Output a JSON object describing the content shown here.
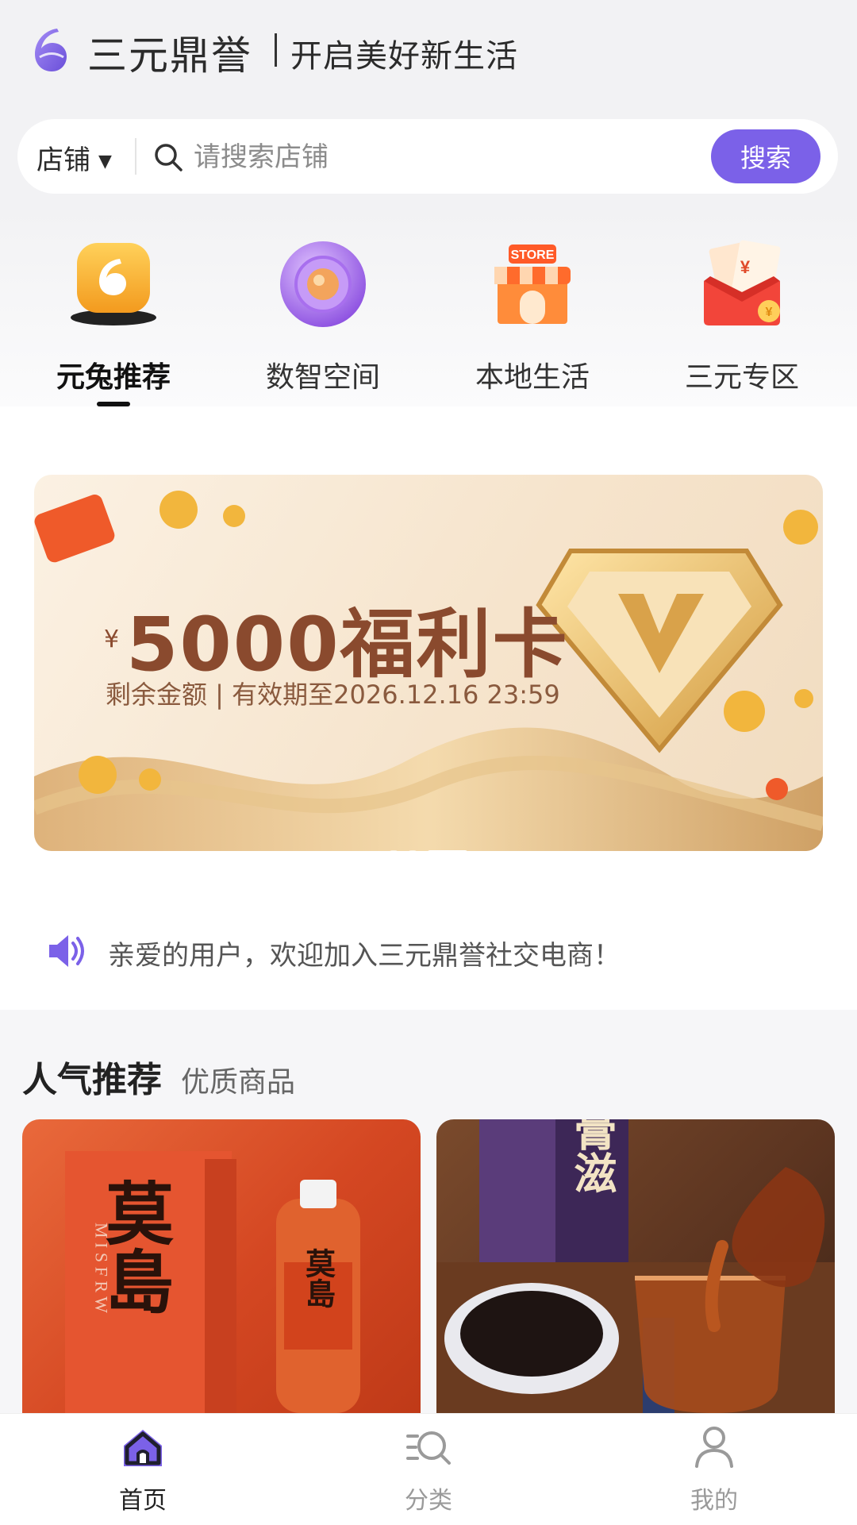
{
  "header": {
    "brand": "三元鼎誉",
    "slogan": "开启美好新生活"
  },
  "search": {
    "scope": "店铺",
    "placeholder": "请搜索店铺",
    "button": "搜索"
  },
  "categories": [
    {
      "label": "元兔推荐",
      "icon": "rabbit-logo-icon",
      "active": true
    },
    {
      "label": "数智空间",
      "icon": "target-orb-icon",
      "active": false
    },
    {
      "label": "本地生活",
      "icon": "store-icon",
      "active": false
    },
    {
      "label": "三元专区",
      "icon": "red-envelope-icon",
      "active": false
    }
  ],
  "banner": {
    "currency": "¥",
    "title": "5000福利卡",
    "subtitle": "剩余金额 | 有效期至2026.12.16 23:59",
    "slide_count": 3,
    "active_slide": 3
  },
  "notice": {
    "text": "亲爱的用户，欢迎加入三元鼎誉社交电商！"
  },
  "section": {
    "title": "人气推荐",
    "subtitle": "优质商品",
    "products": [
      {
        "name": "莫島",
        "box_letters": "M I S F R W"
      },
      {
        "name": "膏滋"
      }
    ]
  },
  "tabbar": [
    {
      "label": "首页",
      "icon": "home-icon",
      "active": true
    },
    {
      "label": "分类",
      "icon": "category-search-icon",
      "active": false
    },
    {
      "label": "我的",
      "icon": "user-icon",
      "active": false
    }
  ],
  "colors": {
    "accent": "#7b61e8",
    "banner_text": "#8a4a2e",
    "active_tab": "#222222",
    "inactive_tab": "#9a9a9a"
  }
}
